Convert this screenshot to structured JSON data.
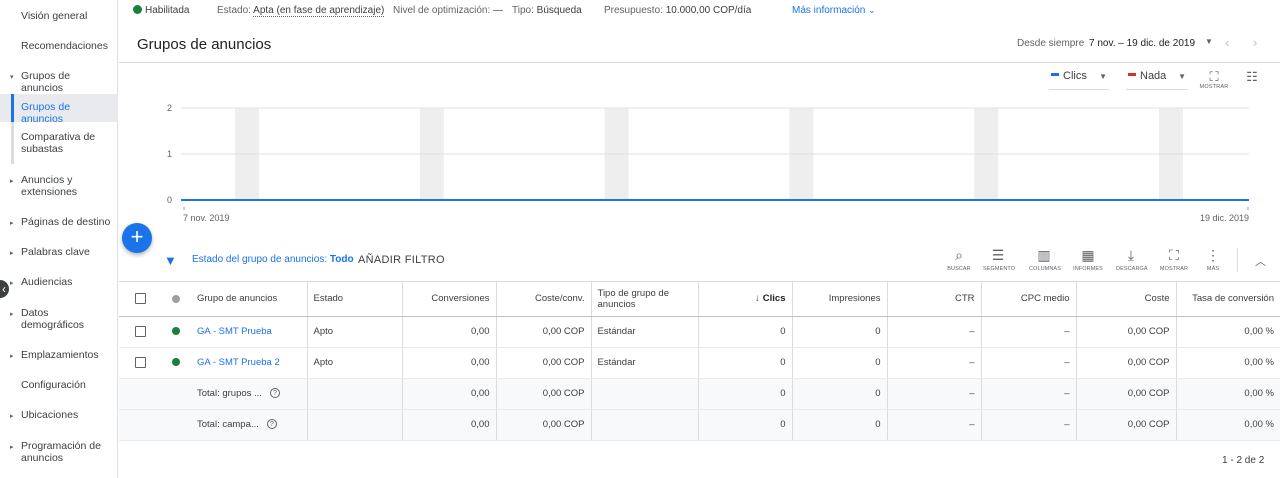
{
  "sidebar": {
    "items": [
      {
        "label": "Visión general",
        "caret": false
      },
      {
        "label": "Recomendaciones",
        "caret": false
      },
      {
        "label": "Grupos de anuncios",
        "caret": true,
        "caret_glyph": "▾"
      },
      {
        "label": "Grupos de anuncios",
        "caret": false,
        "active": true
      },
      {
        "label": "Comparativa de subastas",
        "caret": false
      },
      {
        "label": "Anuncios y extensiones",
        "caret": true,
        "caret_glyph": "▸"
      },
      {
        "label": "Páginas de destino",
        "caret": true,
        "caret_glyph": "▸"
      },
      {
        "label": "Palabras clave",
        "caret": true,
        "caret_glyph": "▸"
      },
      {
        "label": "Audiencias",
        "caret": true,
        "caret_glyph": "▸"
      },
      {
        "label": "Datos demográficos",
        "caret": true,
        "caret_glyph": "▸"
      },
      {
        "label": "Emplazamientos",
        "caret": true,
        "caret_glyph": "▸"
      },
      {
        "label": "Configuración",
        "caret": false
      },
      {
        "label": "Ubicaciones",
        "caret": true,
        "caret_glyph": "▸"
      },
      {
        "label": "Programación de anuncios",
        "caret": true,
        "caret_glyph": "▸"
      }
    ]
  },
  "status_bar": {
    "status": "Habilitada",
    "estado_label": "Estado:",
    "estado_value": "Apta (en fase de aprendizaje)",
    "opt_label": "Nivel de optimización:",
    "opt_value": "—",
    "tipo_label": "Tipo:",
    "tipo_value": "Búsqueda",
    "budget_label": "Presupuesto:",
    "budget_value": "10.000,00 COP/día",
    "more_info": "Más información"
  },
  "header": {
    "title": "Grupos de anuncios",
    "date_label": "Desde siempre",
    "date_range": "7 nov. – 19 dic. de 2019"
  },
  "chart_controls": {
    "metric1": "Clics",
    "metric1_color": "#1a73e8",
    "metric2": "Nada",
    "metric2_color": "#d93025",
    "expand_label": "MOSTRAR"
  },
  "chart_data": {
    "type": "line",
    "x": [
      "7 nov. 2019",
      "19 dic. 2019"
    ],
    "series": [
      {
        "values": [
          0,
          0
        ]
      }
    ],
    "xlabel": "",
    "ylabel": "",
    "ylim": [
      0,
      2
    ],
    "yticks": [
      "2",
      "1",
      "0"
    ],
    "xtick_labels": [
      "7 nov. 2019",
      "19 dic. 2019"
    ],
    "grid": true,
    "weekend_bands": 6
  },
  "fab": {
    "label": "+"
  },
  "filter_bar": {
    "filter_label": "Estado del grupo de anuncios:",
    "filter_value": "Todo",
    "add_filter": "AÑADIR FILTRO",
    "tools": [
      {
        "label": "BUSCAR",
        "glyph": "⌕"
      },
      {
        "label": "SEGMENTO",
        "glyph": "☰"
      },
      {
        "label": "COLUMNAS",
        "glyph": "▥"
      },
      {
        "label": "INFORMES",
        "glyph": "▦"
      },
      {
        "label": "DESCARGA",
        "glyph": "⤓"
      },
      {
        "label": "MOSTRAR",
        "glyph": "⛶"
      },
      {
        "label": "MÁS",
        "glyph": "⋮"
      }
    ]
  },
  "table": {
    "columns": [
      "Grupo de anuncios",
      "Estado",
      "Conversiones",
      "Coste/conv.",
      "Tipo de grupo de anuncios",
      "Clics",
      "Impresiones",
      "CTR",
      "CPC medio",
      "Coste",
      "Tasa de conversión"
    ],
    "rows": [
      {
        "name": "GA - SMT Prueba",
        "estado": "Apto",
        "conversiones": "0,00",
        "coste_conv": "0,00 COP",
        "tipo": "Estándar",
        "clics": "0",
        "impresiones": "0",
        "ctr": "–",
        "cpc": "–",
        "coste": "0,00 COP",
        "tasa": "0,00 %"
      },
      {
        "name": "GA - SMT Prueba 2",
        "estado": "Apto",
        "conversiones": "0,00",
        "coste_conv": "0,00 COP",
        "tipo": "Estándar",
        "clics": "0",
        "impresiones": "0",
        "ctr": "–",
        "cpc": "–",
        "coste": "0,00 COP",
        "tasa": "0,00 %"
      }
    ],
    "totals": [
      {
        "name": "Total: grupos ...",
        "conversiones": "0,00",
        "coste_conv": "0,00 COP",
        "clics": "0",
        "impresiones": "0",
        "ctr": "–",
        "cpc": "–",
        "coste": "0,00 COP",
        "tasa": "0,00 %"
      },
      {
        "name": "Total: campa...",
        "conversiones": "0,00",
        "coste_conv": "0,00 COP",
        "clics": "0",
        "impresiones": "0",
        "ctr": "–",
        "cpc": "–",
        "coste": "0,00 COP",
        "tasa": "0,00 %"
      }
    ]
  },
  "pagination": "1 - 2 de 2"
}
